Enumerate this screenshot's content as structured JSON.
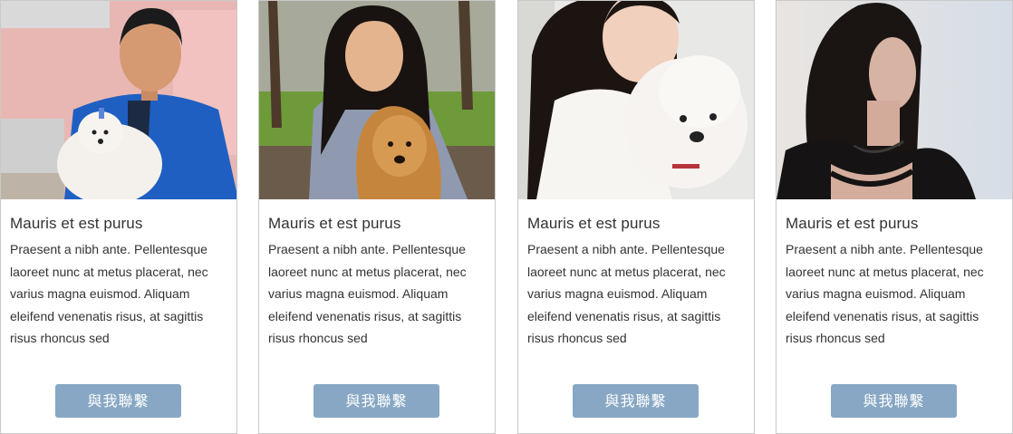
{
  "cards": [
    {
      "title": "Mauris et est purus",
      "description": "Praesent a nibh ante. Pellentesque laoreet nunc at metus placerat, nec varius magna euismod. Aliquam eleifend venenatis risus, at sagittis risus rhoncus sed",
      "button_label": "與我聯繫"
    },
    {
      "title": "Mauris et est purus",
      "description": "Praesent a nibh ante. Pellentesque laoreet nunc at metus placerat, nec varius magna euismod. Aliquam eleifend venenatis risus, at sagittis risus rhoncus sed",
      "button_label": "與我聯繫"
    },
    {
      "title": "Mauris et est purus",
      "description": "Praesent a nibh ante. Pellentesque laoreet nunc at metus placerat, nec varius magna euismod. Aliquam eleifend venenatis risus, at sagittis risus rhoncus sed",
      "button_label": "與我聯繫"
    },
    {
      "title": "Mauris et est purus",
      "description": "Praesent a nibh ante. Pellentesque laoreet nunc at metus placerat, nec varius magna euismod. Aliquam eleifend venenatis risus, at sagittis risus rhoncus sed",
      "button_label": "與我聯繫"
    }
  ],
  "colors": {
    "button": "#87a7c4",
    "border": "#c9c9c9",
    "text": "#333333"
  }
}
